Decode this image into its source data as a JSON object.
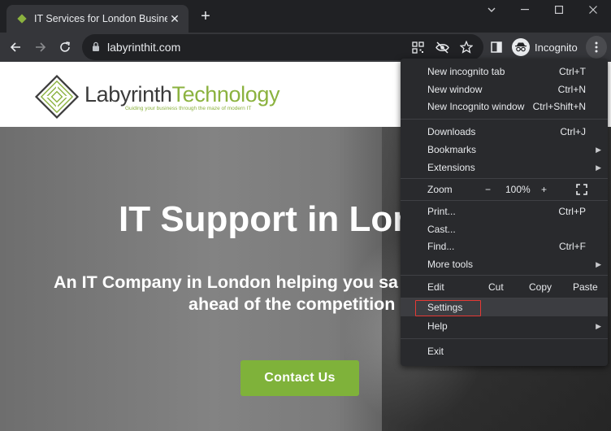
{
  "browser": {
    "tab": {
      "title": "IT Services for London Business -"
    },
    "address": {
      "url": "labyrinthit.com"
    },
    "profile_label": "Incognito"
  },
  "site": {
    "logo": {
      "word1": "Labyrinth",
      "word2": "Technology",
      "tagline": "Guiding your business through the maze of modern IT"
    },
    "hero": {
      "title": "IT Support in Lon",
      "subtitle_line1": "An IT Company in London helping you sa",
      "subtitle_line2": "ahead of the competition",
      "cta": "Contact Us"
    }
  },
  "menu": {
    "new_incognito_tab": {
      "label": "New incognito tab",
      "shortcut": "Ctrl+T"
    },
    "new_window": {
      "label": "New window",
      "shortcut": "Ctrl+N"
    },
    "new_incognito_window": {
      "label": "New Incognito window",
      "shortcut": "Ctrl+Shift+N"
    },
    "downloads": {
      "label": "Downloads",
      "shortcut": "Ctrl+J"
    },
    "bookmarks": {
      "label": "Bookmarks"
    },
    "extensions": {
      "label": "Extensions"
    },
    "zoom": {
      "label": "Zoom",
      "minus": "−",
      "value": "100%",
      "plus": "+"
    },
    "print": {
      "label": "Print...",
      "shortcut": "Ctrl+P"
    },
    "cast": {
      "label": "Cast..."
    },
    "find": {
      "label": "Find...",
      "shortcut": "Ctrl+F"
    },
    "more_tools": {
      "label": "More tools"
    },
    "edit": {
      "label": "Edit",
      "cut": "Cut",
      "copy": "Copy",
      "paste": "Paste"
    },
    "settings": {
      "label": "Settings"
    },
    "help": {
      "label": "Help"
    },
    "exit": {
      "label": "Exit"
    }
  },
  "colors": {
    "highlight_box": "#e53935",
    "brand_green": "#8bb23f",
    "cta_green": "#7fb23a"
  }
}
